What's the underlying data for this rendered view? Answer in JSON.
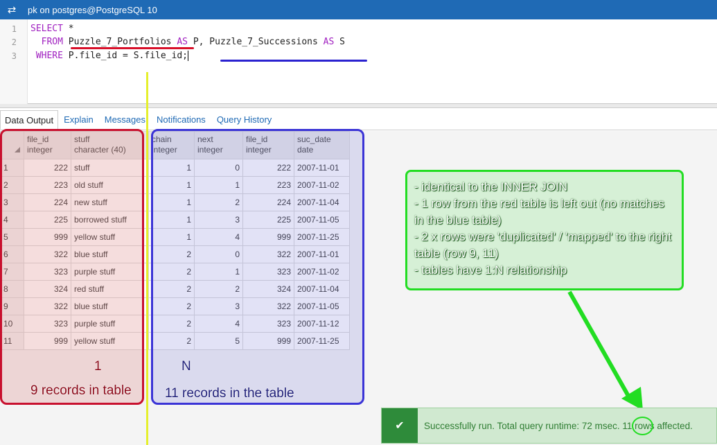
{
  "titlebar": {
    "icon": "connection-icon",
    "title": "pk on postgres@PostgreSQL 10"
  },
  "editor": {
    "lines": [
      {
        "no": "1",
        "parts": [
          [
            "kw",
            "SELECT"
          ],
          [
            "t",
            " *"
          ]
        ]
      },
      {
        "no": "2",
        "parts": [
          [
            "t",
            "  "
          ],
          [
            "kw",
            "FROM"
          ],
          [
            "t",
            " Puzzle_7_Portfolios "
          ],
          [
            "kw",
            "AS"
          ],
          [
            "t",
            " P, Puzzle_7_Successions "
          ],
          [
            "kw",
            "AS"
          ],
          [
            "t",
            " S"
          ]
        ]
      },
      {
        "no": "3",
        "parts": [
          [
            "t",
            " "
          ],
          [
            "kw",
            "WHERE"
          ],
          [
            "t",
            " P.file_id = S.file_id;"
          ]
        ]
      }
    ]
  },
  "tabs": [
    "Data Output",
    "Explain",
    "Messages",
    "Notifications",
    "Query History"
  ],
  "grid": {
    "columns": [
      {
        "name": "file_id",
        "type": "integer"
      },
      {
        "name": "stuff",
        "type": "character (40)"
      },
      {
        "name": "chain",
        "type": "integer"
      },
      {
        "name": "next",
        "type": "integer"
      },
      {
        "name": "file_id",
        "type": "integer"
      },
      {
        "name": "suc_date",
        "type": "date"
      }
    ],
    "rows": [
      [
        "1",
        "222",
        "stuff",
        "1",
        "0",
        "222",
        "2007-11-01"
      ],
      [
        "2",
        "223",
        "old stuff",
        "1",
        "1",
        "223",
        "2007-11-02"
      ],
      [
        "3",
        "224",
        "new stuff",
        "1",
        "2",
        "224",
        "2007-11-04"
      ],
      [
        "4",
        "225",
        "borrowed stuff",
        "1",
        "3",
        "225",
        "2007-11-05"
      ],
      [
        "5",
        "999",
        "yellow stuff",
        "1",
        "4",
        "999",
        "2007-11-25"
      ],
      [
        "6",
        "322",
        "blue stuff",
        "2",
        "0",
        "322",
        "2007-11-01"
      ],
      [
        "7",
        "323",
        "purple stuff",
        "2",
        "1",
        "323",
        "2007-11-02"
      ],
      [
        "8",
        "324",
        "red stuff",
        "2",
        "2",
        "324",
        "2007-11-04"
      ],
      [
        "9",
        "322",
        "blue stuff",
        "2",
        "3",
        "322",
        "2007-11-05"
      ],
      [
        "10",
        "323",
        "purple stuff",
        "2",
        "4",
        "323",
        "2007-11-12"
      ],
      [
        "11",
        "999",
        "yellow stuff",
        "2",
        "5",
        "999",
        "2007-11-25"
      ]
    ]
  },
  "annotations": {
    "red_label_1": "1",
    "red_label_2": "9 records in table",
    "blue_label_1": "N",
    "blue_label_2": "11 records in the table",
    "note_lines": [
      "- identical to the INNER JOIN",
      "- 1 row from the red table is left out (no matches in the blue table)",
      "- 2 x rows were 'duplicated' / 'mapped' to the right table (row 9, 11)",
      "- tables have 1:N relationship"
    ]
  },
  "status": {
    "icon": "check-icon",
    "message": "Successfully run. Total query runtime: 72 msec. 11 rows affected."
  }
}
